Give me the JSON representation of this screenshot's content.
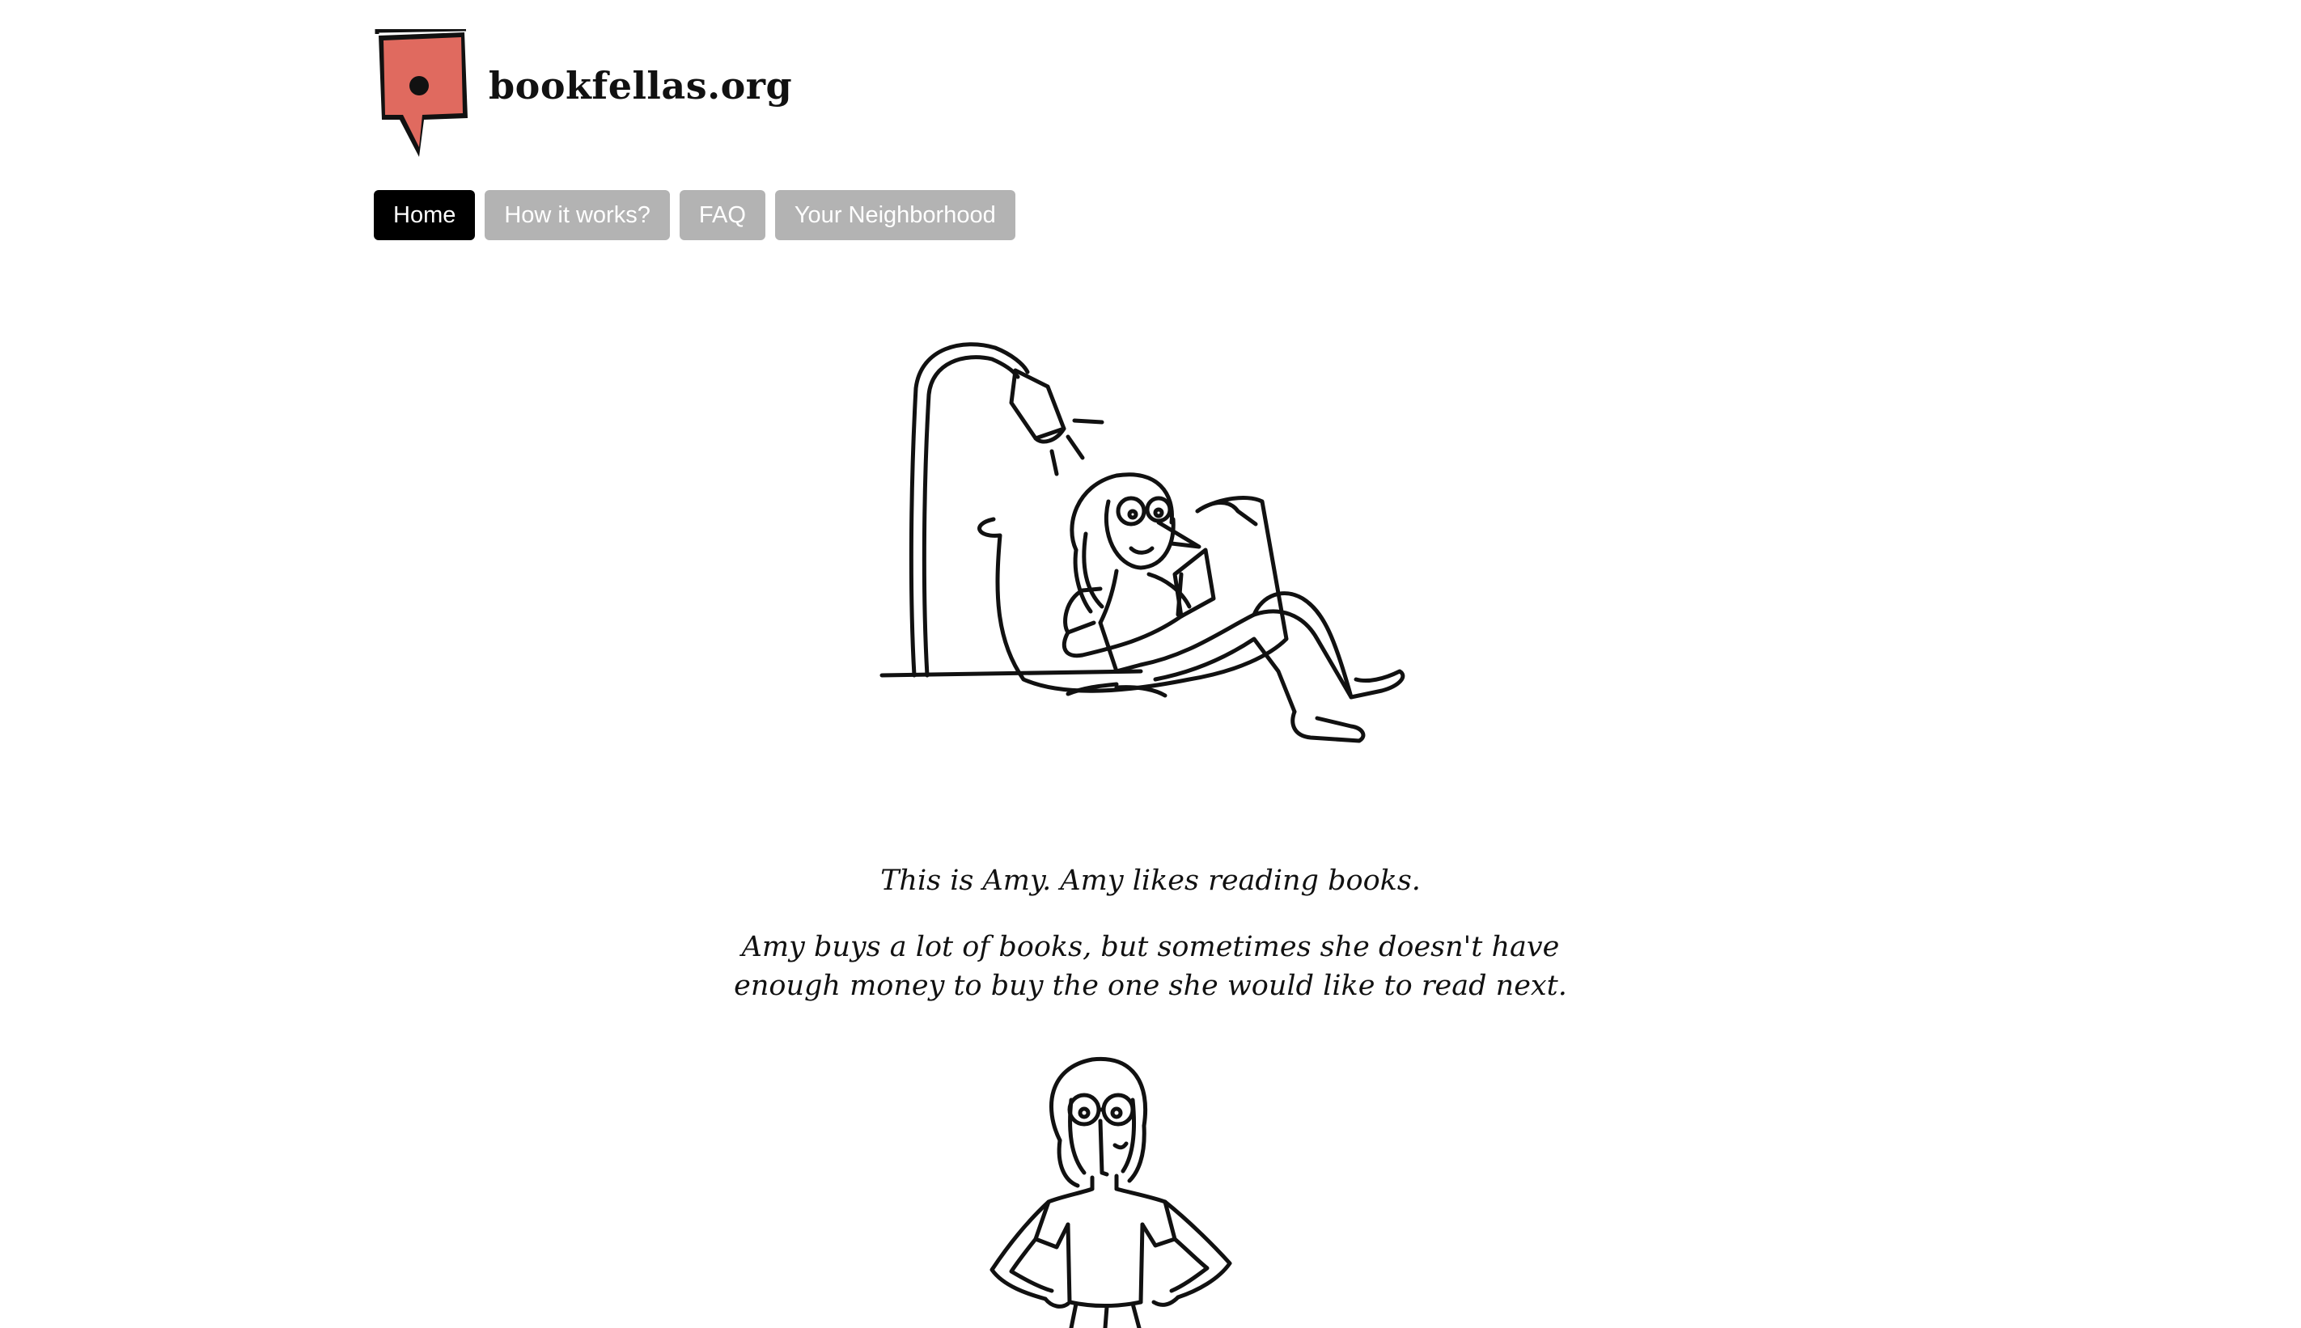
{
  "site": {
    "logo_text": "bookfellas.org",
    "logo_color": "#e06a5f"
  },
  "nav": {
    "items": [
      {
        "label": "Home",
        "active": true
      },
      {
        "label": "How it works?",
        "active": false
      },
      {
        "label": "FAQ",
        "active": false
      },
      {
        "label": "Your Neighborhood",
        "active": false
      }
    ]
  },
  "story": {
    "paragraph_1": "This is Amy. Amy likes reading books.",
    "paragraph_2": "Amy buys a lot of books, but sometimes she doesn't have enough money to buy the one she would like to read next."
  },
  "colors": {
    "nav_active_bg": "#000000",
    "nav_inactive_bg": "#b3b3b3",
    "nav_text": "#ffffff"
  }
}
